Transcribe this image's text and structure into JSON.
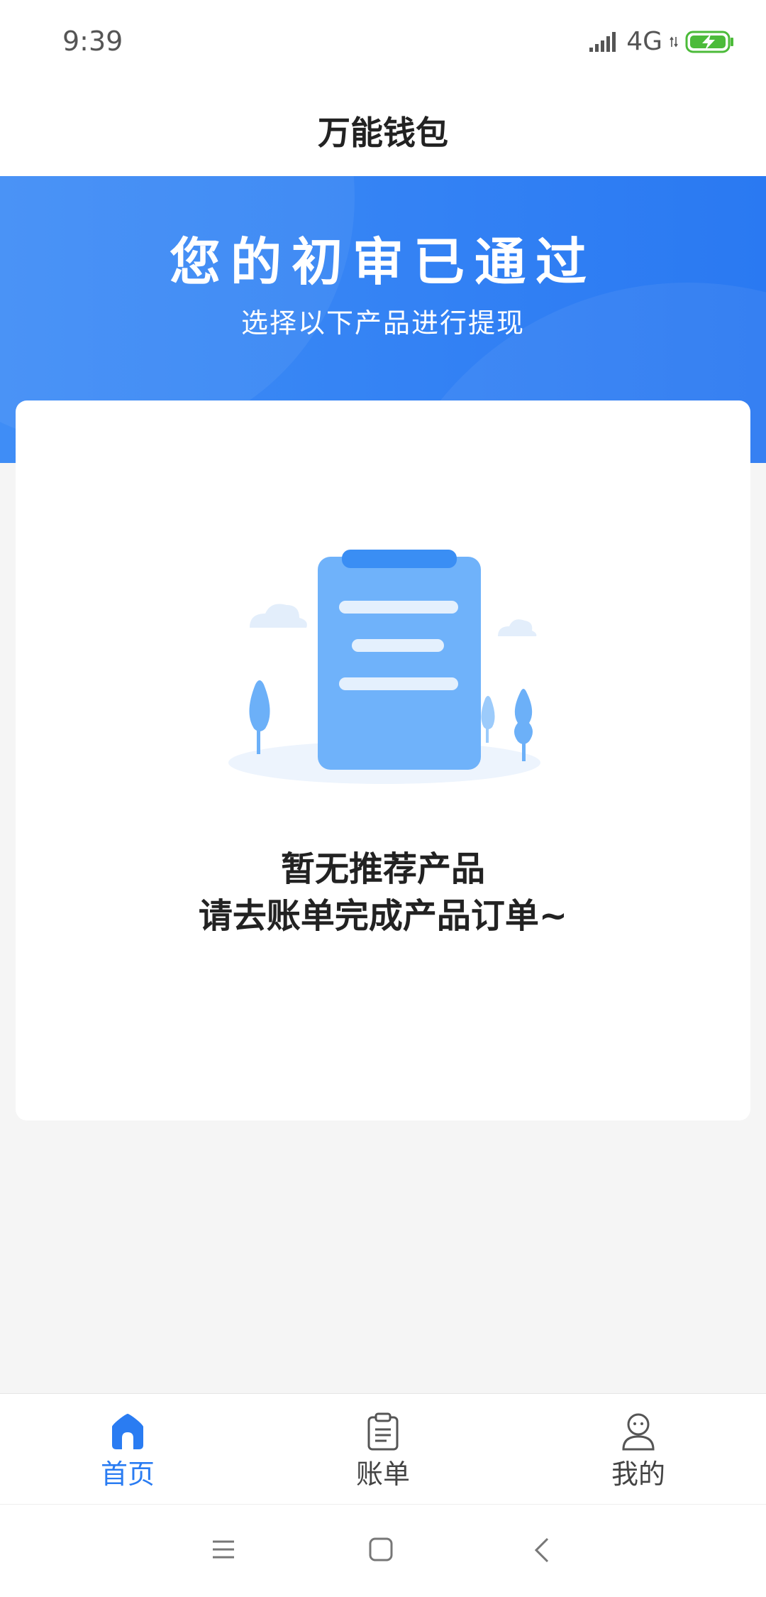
{
  "status_bar": {
    "time": "9:39",
    "network": "4G"
  },
  "header": {
    "title": "万能钱包"
  },
  "hero": {
    "title": "您的初审已通过",
    "subtitle": "选择以下产品进行提现"
  },
  "empty_state": {
    "title": "暂无推荐产品",
    "description": "请去账单完成产品订单~"
  },
  "tabs": [
    {
      "label": "首页",
      "icon": "home-icon",
      "active": true
    },
    {
      "label": "账单",
      "icon": "clipboard-icon",
      "active": false
    },
    {
      "label": "我的",
      "icon": "user-icon",
      "active": false
    }
  ],
  "colors": {
    "accent": "#2a7cf2",
    "battery": "#4cbb3a"
  }
}
